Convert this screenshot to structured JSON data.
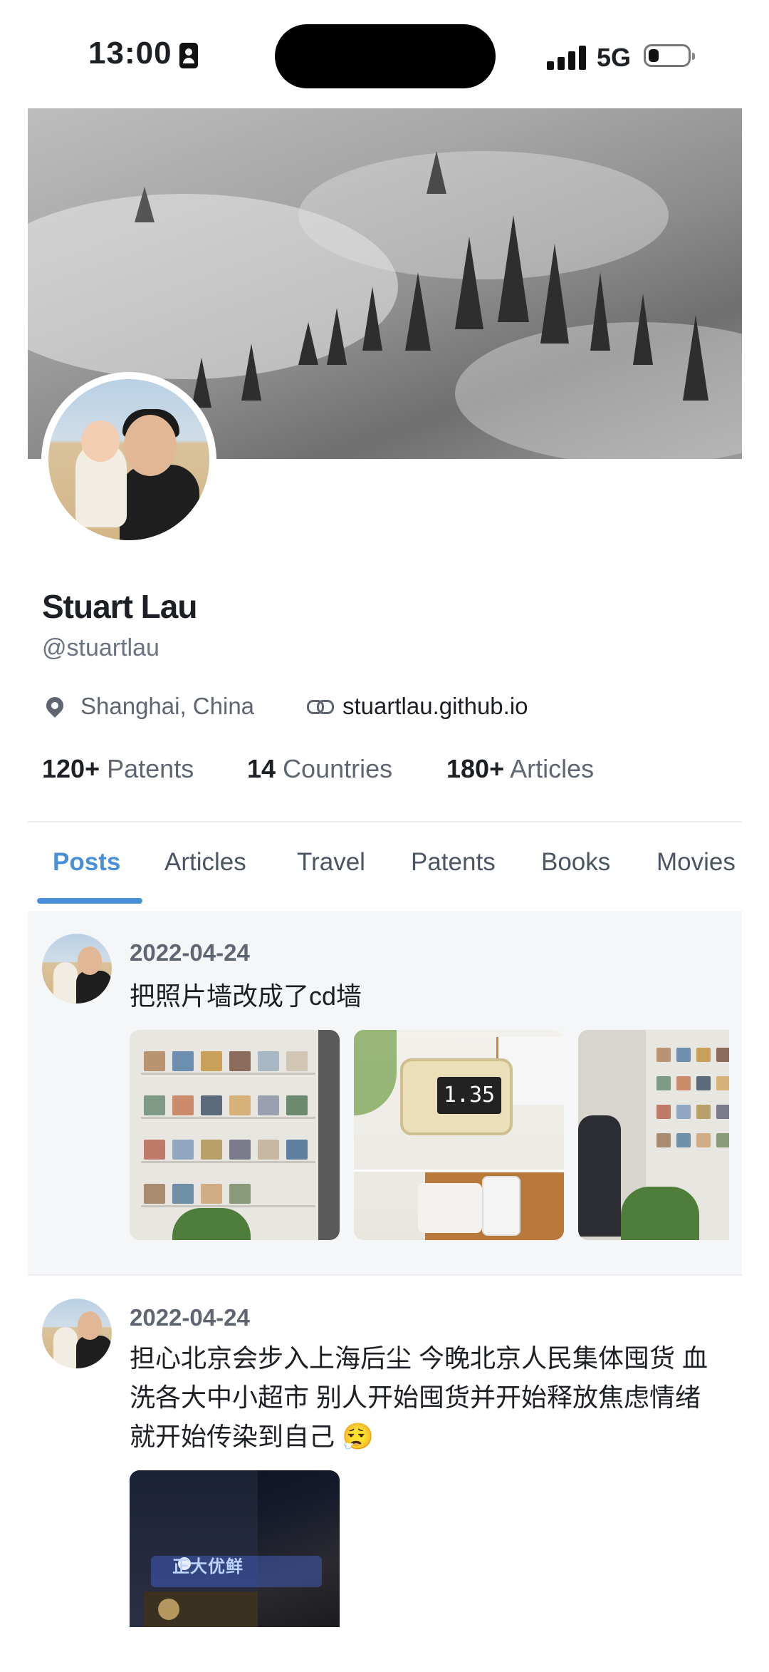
{
  "status_bar": {
    "time": "13:00",
    "network": "5G"
  },
  "profile": {
    "name": "Stuart Lau",
    "handle": "@stuartlau",
    "location": "Shanghai, China",
    "website": "stuartlau.github.io",
    "stats": [
      {
        "value": "120+",
        "label": "Patents"
      },
      {
        "value": "14",
        "label": "Countries"
      },
      {
        "value": "180+",
        "label": "Articles"
      }
    ]
  },
  "tabs": [
    "Posts",
    "Articles",
    "Travel",
    "Patents",
    "Books",
    "Movies"
  ],
  "active_tab": "Posts",
  "posts": [
    {
      "date": "2022-04-24",
      "text": "把照片墙改成了cd墙",
      "clock_display": "1.35"
    },
    {
      "date": "2022-04-24",
      "text": "担心北京会步入上海后尘 今晚北京人民集体囤货 血洗各大中小超市 别人开始囤货并开始释放焦虑情绪 就开始传染到自己 😮‍💨",
      "sign_text": "正大优鲜"
    }
  ],
  "colors": {
    "accent": "#4a90d9",
    "muted": "#5f6672",
    "text": "#1c1f24"
  }
}
